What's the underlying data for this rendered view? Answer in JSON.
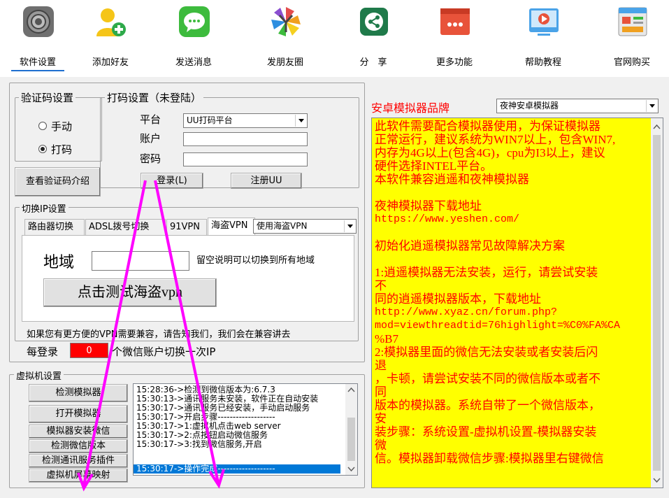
{
  "toolbar": {
    "items": [
      {
        "label": "软件设置",
        "icon": "settings-gear-icon"
      },
      {
        "label": "添加好友",
        "icon": "add-friend-icon"
      },
      {
        "label": "发送消息",
        "icon": "message-bubble-icon"
      },
      {
        "label": "发朋友圈",
        "icon": "moments-aperture-icon"
      },
      {
        "label": "分　享",
        "icon": "share-icon"
      },
      {
        "label": "更多功能",
        "icon": "more-functions-icon"
      },
      {
        "label": "帮助教程",
        "icon": "video-tutorial-icon"
      },
      {
        "label": "官网购买",
        "icon": "store-purchase-icon"
      }
    ],
    "active_index": 0,
    "accent_color": "#1f6fd0"
  },
  "captcha": {
    "title": "验证码设置",
    "manual_label": "手动",
    "auto_label": "打码",
    "selected": "打码",
    "intro_button": "查看验证码介绍"
  },
  "coding": {
    "title": "打码设置（未登陆）",
    "platform_label": "平台",
    "platform_value": "UU打码平台",
    "account_label": "账户",
    "account_value": "",
    "password_label": "密码",
    "password_value": "",
    "login_button": "登录(L)",
    "register_button": "注册UU"
  },
  "ip": {
    "title": "切换IP设置",
    "tabs": [
      "路由器切换",
      "ADSL拨号切换",
      "91VPN",
      "海盗VPN"
    ],
    "active_tab": "海盗VPN",
    "vpn_select": "使用海盗VPN",
    "region_label": "地域",
    "region_value": "",
    "region_hint": "留空说明可以切换到所有地域",
    "test_button": "点击测试海盗vpn",
    "footer_note": "如果您有更方便的VPN需要兼容，请告知我们，我们会在兼容讲去",
    "per_login_prefix": "每登录",
    "per_login_value": "0",
    "per_login_suffix": "个微信账户切换一次IP",
    "counter_color": "#ff0000"
  },
  "vm": {
    "title": "虚拟机设置",
    "buttons": [
      "检测模拟器",
      "打开模拟器",
      "模拟器安装微信",
      "检测微信版本",
      "检测通讯服务插件",
      "虚拟机屏幕映射"
    ],
    "log": [
      "15:28:36->检测到微信版本为:6.7.3",
      "15:30:13->通讯服务未安装，软件正在自动安装",
      "15:30:17->通讯服务已经安装，手动启动服务",
      "15:30:17->开启步骤-------------------",
      "15:30:17->1:虚拟机点击web server",
      "15:30:17->2:点按钮启动微信服务",
      "15:30:17->3:找到微信服务,开启",
      "15:30:17->操作完成-------------------"
    ],
    "selected_log_index": 7
  },
  "emulator": {
    "brand_label": "安卓模拟器品牌",
    "brand_value": "夜神安卓模拟器",
    "label_color": "#ff0000",
    "info_bg": "#ffff00",
    "info_lines": [
      "此软件需要配合模拟器使用，为保证模拟器",
      "正常运行，建议系统为WIN7以上，包含WIN7,",
      "内存为4G以上(包含4G)，cpu为I3以上，建议",
      "硬件选择INTEL平台。",
      "本软件兼容逍遥和夜神模拟器",
      "",
      "夜神模拟器下载地址",
      "https://www.yeshen.com/",
      "",
      "初始化逍遥模拟器常见故障解决方案",
      "",
      "1:逍遥模拟器无法安装，运行，请尝试安装",
      "不",
      "同的逍遥模拟器版本，下载地址",
      "http://www.xyaz.cn/forum.php?",
      "mod=viewthreadtid=76highlight=%C0%FA%CA",
      "%B7",
      "2:模拟器里面的微信无法安装或者安装后闪",
      "退",
      "，卡顿，请尝试安装不同的微信版本或者不",
      "同",
      "版本的模拟器。系统自带了一个微信版本，",
      "安",
      "装步骤：系统设置-虚拟机设置-模拟器安装",
      "微",
      "信。模拟器卸载微信步骤:模拟器里右键微信"
    ]
  }
}
